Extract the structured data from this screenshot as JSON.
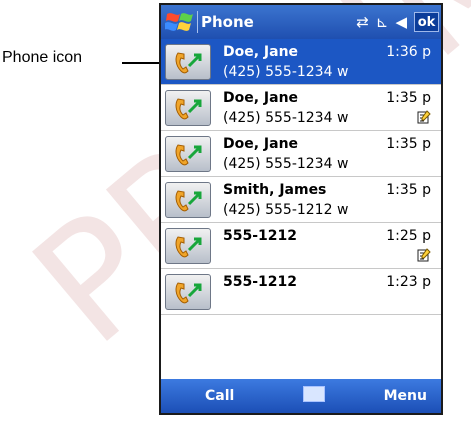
{
  "callout": {
    "label": "Phone icon"
  },
  "window": {
    "title": "Phone",
    "ok_label": "ok",
    "status_icons": [
      "connectivity-icon",
      "signal-icon",
      "speaker-icon"
    ]
  },
  "calls": [
    {
      "name": "Doe, Jane",
      "number": "(425) 555-1234 w",
      "time": "1:36 p",
      "note": false,
      "selected": true
    },
    {
      "name": "Doe, Jane",
      "number": "(425) 555-1234 w",
      "time": "1:35 p",
      "note": true,
      "selected": false
    },
    {
      "name": "Doe, Jane",
      "number": "(425) 555-1234 w",
      "time": "1:35 p",
      "note": false,
      "selected": false
    },
    {
      "name": "Smith, James",
      "number": "(425) 555-1212 w",
      "time": "1:35 p",
      "note": false,
      "selected": false
    },
    {
      "name": "555-1212",
      "number": "",
      "time": "1:25 p",
      "note": true,
      "selected": false
    },
    {
      "name": "555-1212",
      "number": "",
      "time": "1:23 p",
      "note": false,
      "selected": false
    }
  ],
  "softkeys": {
    "left": "Call",
    "right": "Menu",
    "center_icon": "keyboard-icon"
  },
  "colors": {
    "title_blue": "#1f4fb0",
    "selection_blue": "#1c57c4",
    "accent_green": "#18a63b",
    "phone_orange": "#f0a52a"
  }
}
